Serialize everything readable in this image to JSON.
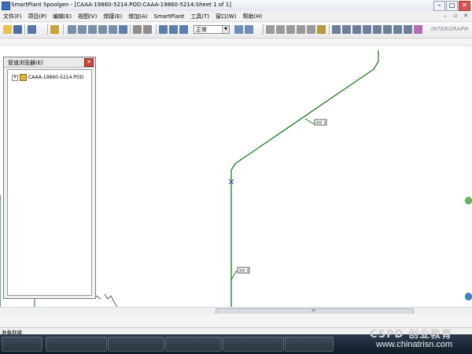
{
  "window": {
    "title": "SmartPlant Spoolgen - [CAAA-19860-5214.POD:CAAA-19860-5214:Sheet 1 of 1]",
    "controls": [
      "–",
      "□",
      "✕"
    ]
  },
  "menu": {
    "items": [
      "文件(F)",
      "项目(P)",
      "编辑(E)",
      "视图(V)",
      "焊接(E)",
      "增加(A)",
      "SmartPlant",
      "工具(T)",
      "窗口(W)",
      "帮助(H)"
    ],
    "doc_controls": [
      "–",
      "▫",
      "✕"
    ]
  },
  "toolbar": {
    "combo_value": "正常",
    "brand": "INTERGRAPH"
  },
  "panel": {
    "title": "管道浏览器(E)",
    "close": "✕",
    "tree": {
      "expander": "+",
      "label": "CAAA-19860-5214.POD"
    }
  },
  "drawing": {
    "labels": [
      "XXX X",
      "XXX X"
    ],
    "pipe_color": "#1f7a1f"
  },
  "status": {
    "text": "准备就绪"
  },
  "watermark": {
    "logo": "CSPD 创业教育",
    "url": "www.chinatrisn.com"
  }
}
